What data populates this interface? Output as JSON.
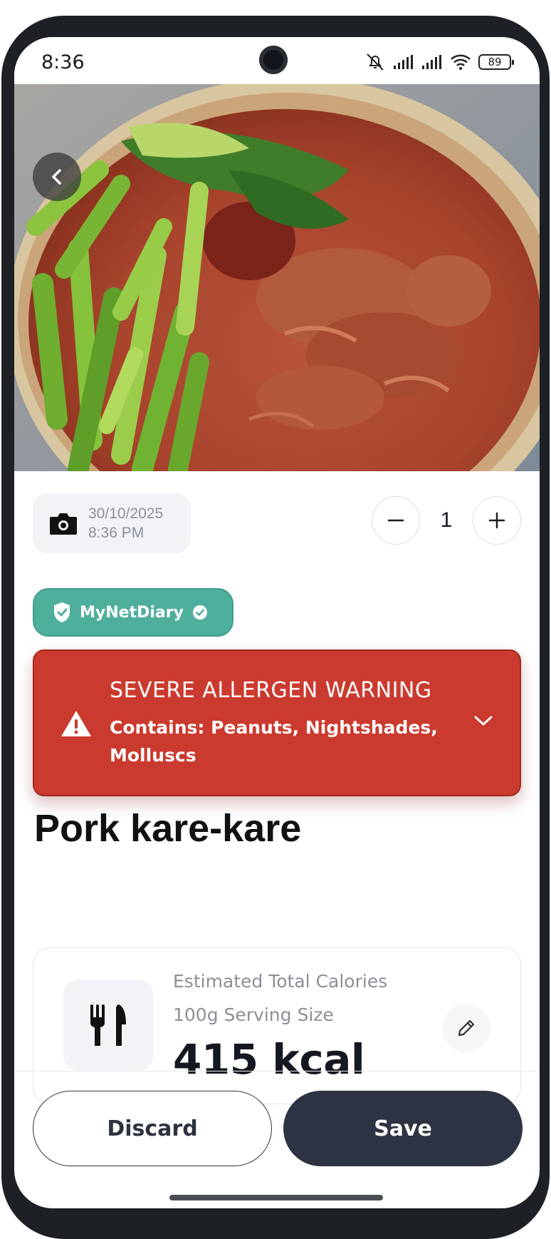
{
  "status_bar": {
    "time": "8:36",
    "battery": "89",
    "icons": [
      "mute-icon",
      "signal-icon",
      "signal-icon",
      "wifi-icon",
      "battery-icon"
    ]
  },
  "entry": {
    "date": "30/10/2025",
    "time": "8:36 PM",
    "quantity": "1"
  },
  "source_badge": {
    "label": "MyNetDiary",
    "color": "#4faf9d"
  },
  "allergen_warning": {
    "title": "SEVERE ALLERGEN WARNING",
    "detail": "Contains: Peanuts, Nightshades, Molluscs",
    "color": "#cb3a2e"
  },
  "food": {
    "name": "Pork kare-kare"
  },
  "calories": {
    "label": "Estimated Total Calories",
    "serving": "100g Serving Size",
    "value": "415 kcal"
  },
  "actions": {
    "discard": "Discard",
    "save": "Save"
  },
  "colors": {
    "primary_dark": "#2d3342",
    "muted_text": "#8a8f98"
  }
}
